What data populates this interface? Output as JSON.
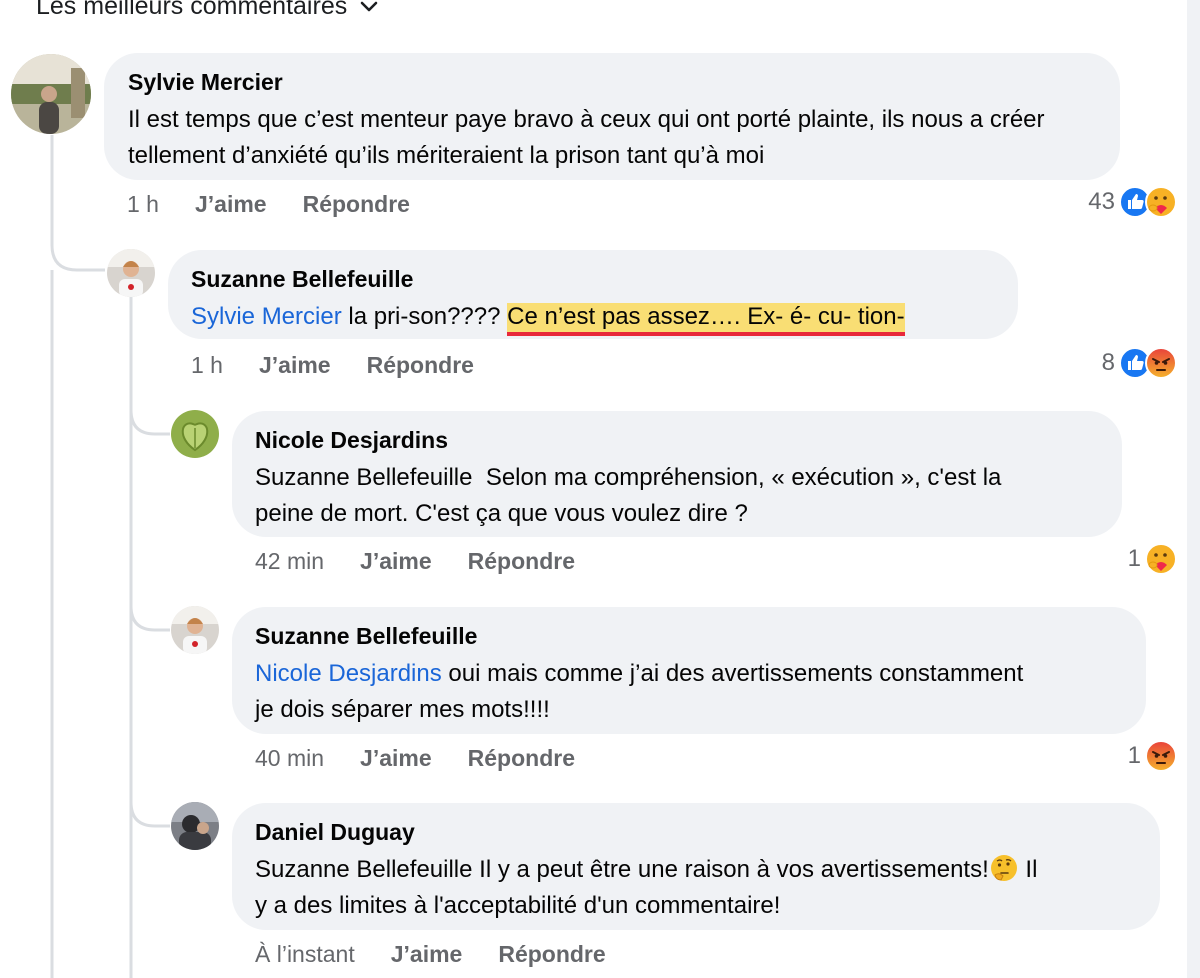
{
  "sort": {
    "label": "Les meilleurs commentaires"
  },
  "comments": [
    {
      "author": "Sylvie Mercier",
      "text": "Il est temps que c’est menteur paye bravo à ceux qui ont porté plainte, ils nous a créer tellement d’anxiété qu’ils mériteraient la prison tant qu’à moi",
      "time": "1 h",
      "like": "J’aime",
      "reply": "Répondre",
      "reaction_count": "43",
      "reactions": [
        "like-icon",
        "care-icon"
      ]
    },
    {
      "author": "Suzanne Bellefeuille",
      "mention": "Sylvie Mercier",
      "text_before": " la pri-son???? ",
      "text_highlight": "Ce n’est pas assez…. Ex- é- cu- tion-",
      "time": "1 h",
      "like": "J’aime",
      "reply": "Répondre",
      "reaction_count": "8",
      "reactions": [
        "like-icon",
        "angry-icon"
      ]
    },
    {
      "author": "Nicole Desjardins",
      "line1": "Suzanne Bellefeuille  Selon ma compréhension, « exécution », c'est la",
      "line2": "peine de mort. C'est ça que vous voulez dire ?",
      "time": "42 min",
      "like": "J’aime",
      "reply": "Répondre",
      "reaction_count": "1",
      "reactions": [
        "care-icon"
      ]
    },
    {
      "author": "Suzanne Bellefeuille",
      "mention": "Nicole Desjardins",
      "line1": " oui mais comme j’ai des avertissements constamment",
      "line2": "je dois séparer mes mots!!!!",
      "time": "40 min",
      "like": "J’aime",
      "reply": "Répondre",
      "reaction_count": "1",
      "reactions": [
        "angry-icon"
      ]
    },
    {
      "author": "Daniel Duguay",
      "line1a": "Suzanne Bellefeuille Il y a peut être une raison à vos avertissements!",
      "line1b": " Il",
      "line2": "y a des limites à l'acceptabilité d'un commentaire!",
      "time": "À l’instant",
      "like": "J’aime",
      "reply": "Répondre"
    }
  ],
  "colors": {
    "bubble": "#f0f2f5",
    "mention": "#1a66d8",
    "meta": "#65676b",
    "highlight": "#fcd642",
    "underline": "#e8283a"
  }
}
